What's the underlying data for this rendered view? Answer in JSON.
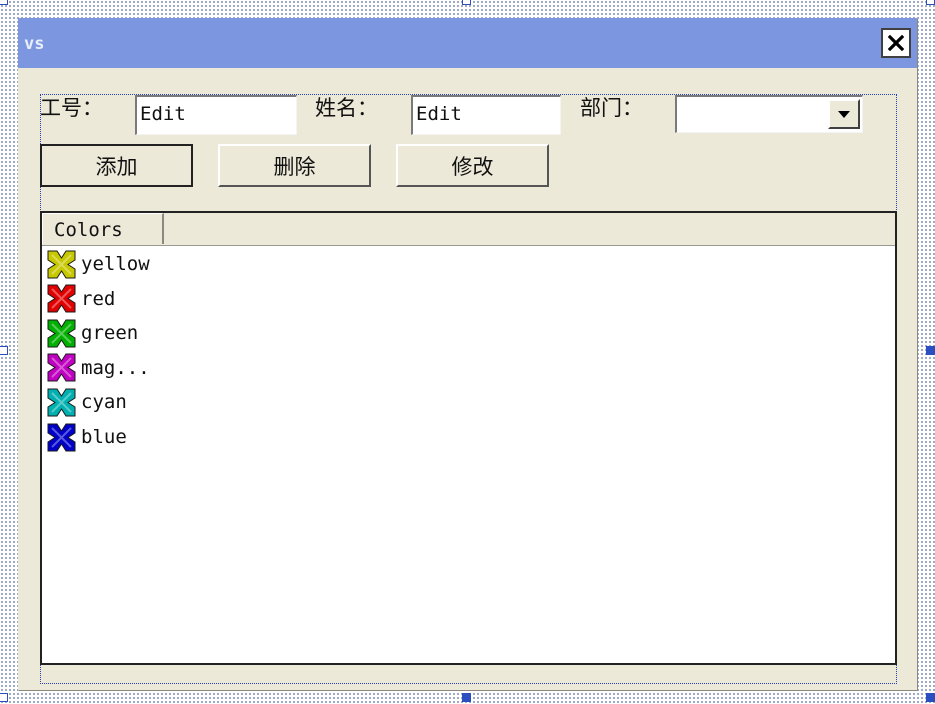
{
  "dialog": {
    "title": "vs",
    "close_icon": "close-icon"
  },
  "form": {
    "id_label": "工号：",
    "id_value": "Edit",
    "name_label": "姓名：",
    "name_value": "Edit",
    "dept_label": "部门：",
    "dept_value": ""
  },
  "buttons": {
    "add": "添加",
    "delete": "删除",
    "modify": "修改"
  },
  "listview": {
    "column": "Colors",
    "items": [
      {
        "label": "yellow",
        "color": "#c8c800"
      },
      {
        "label": "red",
        "color": "#e00000"
      },
      {
        "label": "green",
        "color": "#00b000"
      },
      {
        "label": "mag...",
        "color": "#c000c0"
      },
      {
        "label": "cyan",
        "color": "#00b0b0"
      },
      {
        "label": "blue",
        "color": "#0000c8"
      }
    ]
  }
}
